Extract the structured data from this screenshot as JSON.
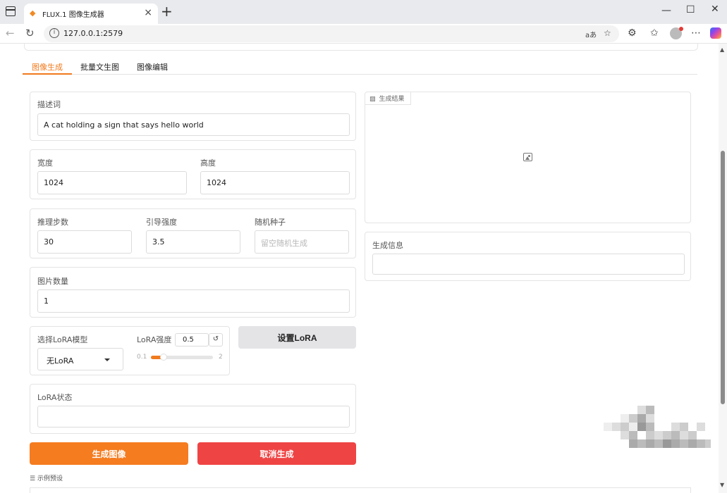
{
  "browser": {
    "tab_title": "FLUX.1 图像生成器",
    "url": "127.0.0.1:2579",
    "read_aloud": "aあ"
  },
  "app_tabs": [
    {
      "label": "图像生成",
      "active": true
    },
    {
      "label": "批量文生图",
      "active": false
    },
    {
      "label": "图像编辑",
      "active": false
    }
  ],
  "prompt": {
    "label": "描述词",
    "value": "A cat holding a sign that says hello world"
  },
  "size": {
    "width_label": "宽度",
    "width_value": "1024",
    "height_label": "高度",
    "height_value": "1024"
  },
  "sampling": {
    "steps_label": "推理步数",
    "steps_value": "30",
    "guidance_label": "引导强度",
    "guidance_value": "3.5",
    "seed_label": "随机种子",
    "seed_placeholder": "留空随机生成"
  },
  "count": {
    "label": "图片数量",
    "value": "1"
  },
  "lora": {
    "select_label": "选择LoRA模型",
    "selected": "无LoRA",
    "strength_label": "LoRA强度",
    "strength_value": "0.5",
    "strength_min": "0.1",
    "strength_max": "2",
    "strength_fraction": 0.21,
    "set_button": "设置LoRA",
    "status_label": "LoRA状态",
    "status_value": ""
  },
  "actions": {
    "generate": "生成图像",
    "cancel": "取消生成"
  },
  "result": {
    "tag": "生成结果",
    "info_label": "生成信息",
    "info_value": ""
  },
  "examples_label": "示例预设",
  "colors": {
    "accent": "#f07a1e",
    "generate": "#f57c1f",
    "cancel": "#ef4444"
  }
}
